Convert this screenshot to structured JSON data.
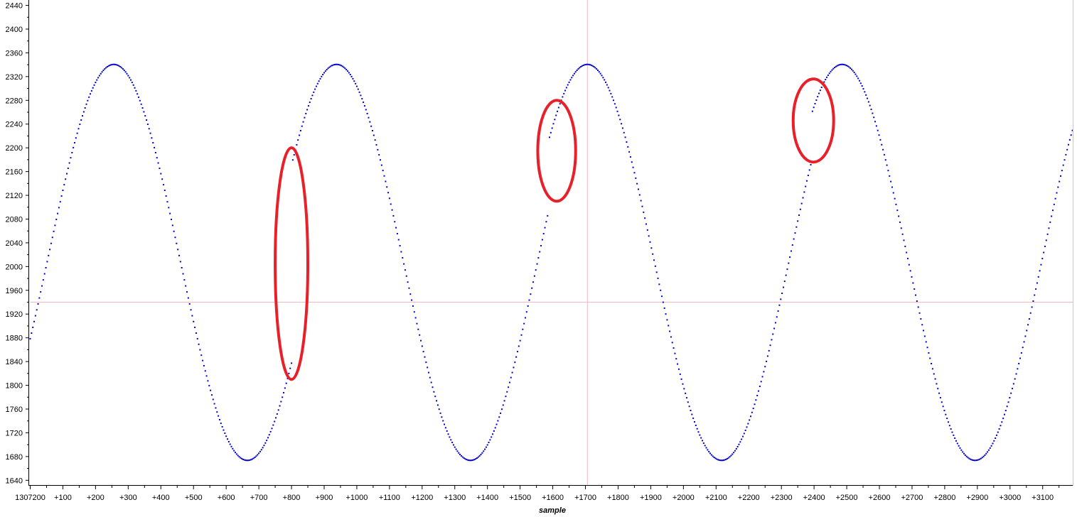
{
  "chart_data": {
    "type": "scatter",
    "xlabel": "sample",
    "ylabel": "",
    "x_origin_label": "1307200",
    "x_offset_tick_prefix": "+",
    "xlim": [
      0,
      3192
    ],
    "ylim": [
      1632,
      2449
    ],
    "y_ticks": [
      1640,
      1680,
      1720,
      1760,
      1800,
      1840,
      1880,
      1920,
      1960,
      2000,
      2040,
      2080,
      2120,
      2160,
      2200,
      2240,
      2280,
      2320,
      2360,
      2400,
      2440
    ],
    "x_ticks": [
      0,
      100,
      200,
      300,
      400,
      500,
      600,
      700,
      800,
      900,
      1000,
      1100,
      1200,
      1300,
      1400,
      1500,
      1600,
      1700,
      1800,
      1900,
      2000,
      2100,
      2200,
      2300,
      2400,
      2500,
      2600,
      2700,
      2800,
      2900,
      3000,
      3100
    ],
    "grid": false,
    "crosshair": {
      "x": 1706,
      "y": 1940
    },
    "series": [
      {
        "color": "#0000cc",
        "point_spacing": 4,
        "description_of_shape": "sinusoid, amplitude ~333, center ~2007, peaks near +256, +938, +1706, +2486; troughs near +665, +1348, +2117, +2893; discontinuities (signal jumps) near +800, +1590, +2395",
        "segments": [
          {
            "x_start": 0,
            "x_end": 800,
            "center": 2007,
            "amplitude": 333.5,
            "peak_x": 256,
            "half_period": 409
          },
          {
            "x_start": 804,
            "x_end": 1586,
            "center": 2007,
            "amplitude": 333.5,
            "peak_x": 938,
            "half_period": 410
          },
          {
            "x_start": 1590,
            "x_end": 2391,
            "center": 2007,
            "amplitude": 333.5,
            "peak_x": 1706,
            "half_period": 411
          },
          {
            "x_start": 2395,
            "x_end": 3192,
            "center": 2007,
            "amplitude": 333.5,
            "peak_x": 2486,
            "half_period": 407
          }
        ]
      }
    ],
    "annotations": [
      {
        "shape": "ellipse",
        "color": "#e8202a",
        "cx": 800,
        "cy": 2005,
        "rx": 50,
        "ry": 195
      },
      {
        "shape": "ellipse",
        "color": "#e8202a",
        "cx": 1612,
        "cy": 2195,
        "rx": 58,
        "ry": 85
      },
      {
        "shape": "ellipse",
        "color": "#e8202a",
        "cx": 2398,
        "cy": 2246,
        "rx": 62,
        "ry": 70
      }
    ]
  }
}
